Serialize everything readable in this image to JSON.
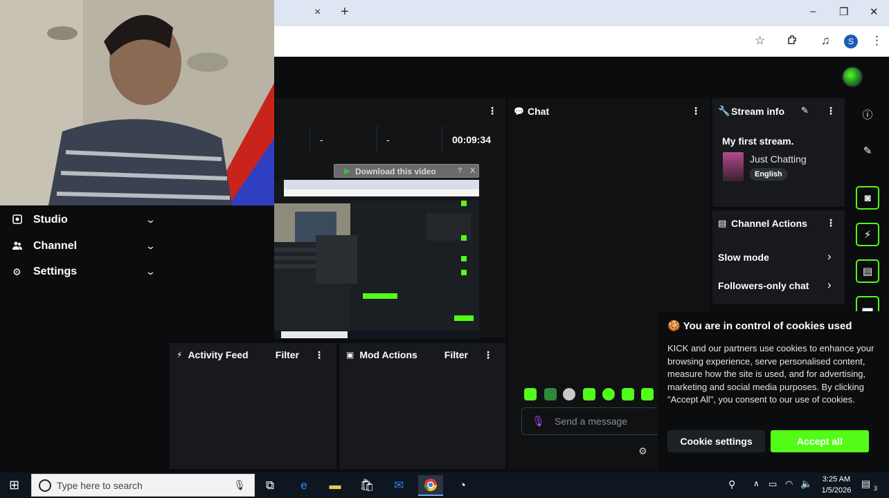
{
  "browser": {
    "tab_close_icon": "×",
    "new_tab_icon": "+",
    "window_controls": [
      "–",
      "❐",
      "✕"
    ],
    "profile_initial": "S"
  },
  "sidebar": {
    "items": [
      {
        "icon": "camera-icon",
        "label": "Studio"
      },
      {
        "icon": "users-icon",
        "label": "Channel"
      },
      {
        "icon": "gear-icon",
        "label": "Settings"
      }
    ]
  },
  "stream": {
    "stats": [
      "-",
      "-"
    ],
    "uptime": "00:09:34",
    "download_bar_label": "Download this video",
    "download_help": "?",
    "download_close": "X"
  },
  "chat": {
    "title": "Chat",
    "message_placeholder": "Send a message"
  },
  "stream_info": {
    "title": "Stream info",
    "stream_title": "My first stream.",
    "category": "Just Chatting",
    "language": "English"
  },
  "channel_actions": {
    "title": "Channel Actions",
    "items": [
      "Slow mode",
      "Followers-only chat"
    ]
  },
  "activity_feed": {
    "title": "Activity Feed",
    "filter_label": "Filter"
  },
  "mod_actions": {
    "title": "Mod Actions",
    "filter_label": "Filter"
  },
  "cookie_dialog": {
    "title": "You are in control of cookies used",
    "body": "KICK and our partners use cookies to enhance your browsing experience, serve personalised content, measure how the site is used, and for advertising, marketing and social media purposes. By clicking \"Accept All\", you consent to our use of cookies.",
    "settings_button": "Cookie settings",
    "accept_button": "Accept all"
  },
  "taskbar": {
    "search_placeholder": "Type here to search",
    "time": "3:25 AM",
    "date": "1/5/2026",
    "notification_count": "3"
  },
  "colors": {
    "accent": "#53fc18",
    "panel": "#17191c",
    "background": "#0b0c0d"
  }
}
